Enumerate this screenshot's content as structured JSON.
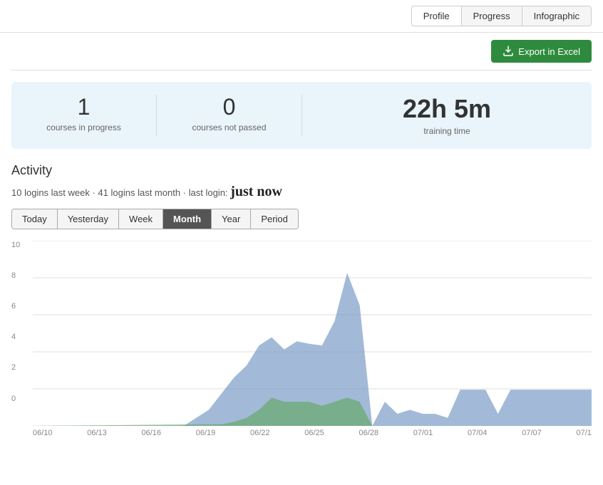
{
  "tabs": {
    "items": [
      {
        "label": "Profile",
        "active": false
      },
      {
        "label": "Progress",
        "active": false
      },
      {
        "label": "Infographic",
        "active": false
      }
    ]
  },
  "toolbar": {
    "export_label": "Export in Excel"
  },
  "stats": {
    "courses_in_progress": "1",
    "courses_in_progress_label": "courses in progress",
    "courses_not_passed": "0",
    "courses_not_passed_label": "courses not passed",
    "training_time": "22h 5m",
    "training_time_label": "training time"
  },
  "activity": {
    "title": "Activity",
    "logins_last_week": "10",
    "logins_last_week_label": "logins last week",
    "logins_last_month": "41",
    "logins_last_month_label": "logins last month",
    "last_login_label": "last login:",
    "last_login_value": "just now"
  },
  "filter_buttons": [
    {
      "label": "Today",
      "active": false
    },
    {
      "label": "Yesterday",
      "active": false
    },
    {
      "label": "Week",
      "active": false
    },
    {
      "label": "Month",
      "active": true
    },
    {
      "label": "Year",
      "active": false
    },
    {
      "label": "Period",
      "active": false
    }
  ],
  "chart": {
    "y_labels": [
      "10",
      "8",
      "6",
      "4",
      "2",
      "0"
    ],
    "x_labels": [
      "06/10",
      "06/13",
      "06/16",
      "06/19",
      "06/22",
      "06/25",
      "06/28",
      "07/01",
      "07/04",
      "07/07",
      "07/1"
    ],
    "colors": {
      "blue_area": "#7a9cc8",
      "green_area": "#6aaa72",
      "grid_line": "#e5e5e5"
    }
  }
}
